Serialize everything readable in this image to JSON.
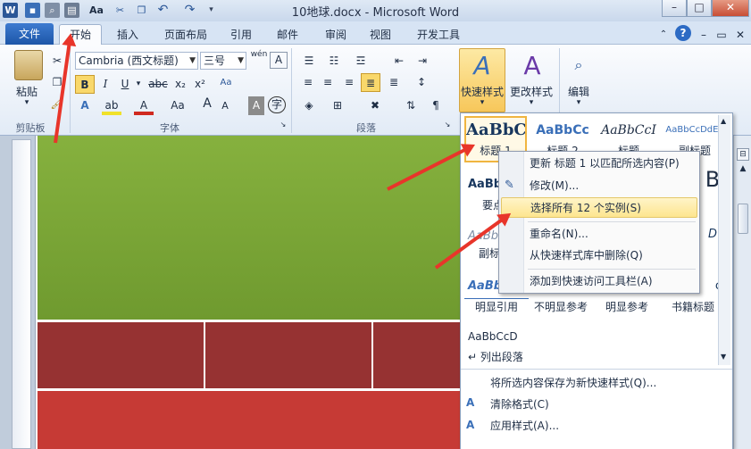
{
  "titlebar": {
    "title": "10地球.docx - Microsoft Word",
    "qat": [
      "word-app-icon",
      "save-icon",
      "print-preview-icon",
      "print-icon",
      "font-icon",
      "format-painter-icon",
      "undo-icon",
      "redo-icon",
      "customize-icon"
    ],
    "qat_aa": "Aa",
    "min": "–",
    "max": "□",
    "close": "✕"
  },
  "tabs": {
    "file": "文件",
    "items": [
      "开始",
      "插入",
      "页面布局",
      "引用",
      "邮件",
      "审阅",
      "视图",
      "开发工具"
    ]
  },
  "ribbon": {
    "clipboard": {
      "label": "剪贴板",
      "paste": "粘贴"
    },
    "font": {
      "label": "字体",
      "font_name": "Cambria (西文标题)",
      "font_size": "三号",
      "wen": "wén",
      "bold": "B",
      "italic": "I",
      "underline": "U",
      "strike": "abc",
      "sub": "x₂",
      "sup": "x²",
      "aa": "Aa",
      "grow": "A",
      "shrink": "A",
      "clear": "A",
      "char_border": "A",
      "enclose": "字",
      "highlight": "ab",
      "color": "A",
      "effects": "A"
    },
    "paragraph": {
      "label": "段落"
    },
    "styles": {
      "quick": "快速样式",
      "change": "更改样式"
    },
    "editing": {
      "label": "编辑"
    }
  },
  "gallery": {
    "row1": [
      {
        "sample": "AaBbC",
        "name": "标题 1"
      },
      {
        "sample": "AaBbCc",
        "name": "标题 2"
      },
      {
        "sample": "AaBbCcI",
        "name": "标题"
      },
      {
        "sample": "AaBbCcDdEe",
        "name": "副标题"
      }
    ],
    "row2_first": {
      "sample": "AaBb",
      "name": "要点"
    },
    "row2_last": "B",
    "row3_first": {
      "sample": "AaBb",
      "name": "副标题"
    },
    "row3_last": "D",
    "row4": [
      {
        "sample": "AaBb",
        "name": "明显引用"
      },
      {
        "sample": "",
        "name": "不明显参考"
      },
      {
        "sample": "",
        "name": "明显参考"
      },
      {
        "sample": "c",
        "name": "书籍标题"
      }
    ],
    "row5": {
      "sample": "AaBbCcD",
      "name": "↵ 列出段落"
    },
    "menu": [
      "将所选内容保存为新快速样式(Q)...",
      "清除格式(C)",
      "应用样式(A)..."
    ]
  },
  "context_menu": {
    "items": [
      "更新 标题 1 以匹配所选内容(P)",
      "修改(M)...",
      "选择所有 12 个实例(S)",
      "重命名(N)...",
      "从快速样式库中删除(Q)",
      "添加到快速访问工具栏(A)"
    ]
  },
  "colors": {
    "accent": "#2b5797",
    "arrow": "#e8352a",
    "green": "#7aa635",
    "dark_red": "#963232",
    "red": "#c63a35",
    "highlight": "#fde58f"
  }
}
